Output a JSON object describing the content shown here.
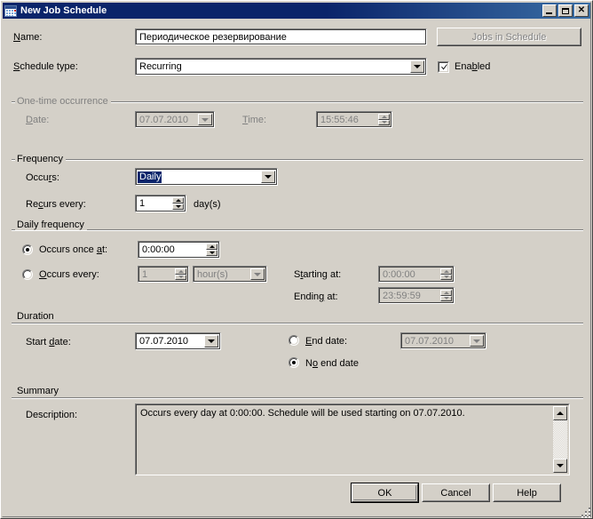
{
  "window": {
    "title": "New Job Schedule",
    "icon": "calendar-icon",
    "minimize_label": "Minimize",
    "maximize_label": "Maximize",
    "close_label": "Close"
  },
  "colors": {
    "face": "#d4d0c8",
    "titlebar_start": "#0a246a",
    "titlebar_end": "#3a6ea5",
    "highlight": "#0a246a",
    "disabled_text": "#808080"
  },
  "top": {
    "name_label": "Name:",
    "name_accel": "N",
    "name_value": "Периодическое резервирование",
    "jobs_button": "Jobs in Schedule",
    "jobs_button_accel": "J",
    "jobs_button_enabled": false,
    "schedule_type_label": "Schedule type:",
    "schedule_type_accel": "S",
    "schedule_type_value": "Recurring",
    "enabled_label": "Enabled",
    "enabled_accel": "b",
    "enabled_checked": true
  },
  "one_time": {
    "group_label": "One-time occurrence",
    "group_enabled": false,
    "date_label": "Date:",
    "date_accel": "D",
    "date_value": "07.07.2010",
    "time_label": "Time:",
    "time_accel": "T",
    "time_value": "15:55:46"
  },
  "frequency": {
    "group_label": "Frequency",
    "occurs_label": "Occurs:",
    "occurs_accel": "r",
    "occurs_value": "Daily",
    "occurs_focused": true,
    "recurs_label": "Recurs every:",
    "recurs_accel": "c",
    "recurs_value": "1",
    "recurs_unit": "day(s)"
  },
  "daily_frequency": {
    "group_label": "Daily frequency",
    "once_radio_label": "Occurs once at:",
    "once_radio_accel": "a",
    "once_radio_selected": true,
    "once_time_value": "0:00:00",
    "every_radio_label": "Occurs every:",
    "every_radio_accel": "O",
    "every_radio_selected": false,
    "every_value": "1",
    "every_unit_value": "hour(s)",
    "starting_label": "Starting at:",
    "starting_accel": "t",
    "starting_value": "0:00:00",
    "ending_label": "Ending at:",
    "ending_accel": "g",
    "ending_value": "23:59:59"
  },
  "duration": {
    "group_label": "Duration",
    "start_date_label": "Start date:",
    "start_date_accel": "d",
    "start_date_value": "07.07.2010",
    "end_date_label": "End date:",
    "end_date_accel": "E",
    "end_date_selected": false,
    "end_date_value": "07.07.2010",
    "no_end_date_label": "No end date",
    "no_end_date_accel": "o",
    "no_end_date_selected": true
  },
  "summary": {
    "group_label": "Summary",
    "description_label": "Description:",
    "description_value": "Occurs every day at 0:00:00. Schedule will be used starting on 07.07.2010."
  },
  "buttons": {
    "ok": "OK",
    "cancel": "Cancel",
    "help": "Help"
  }
}
